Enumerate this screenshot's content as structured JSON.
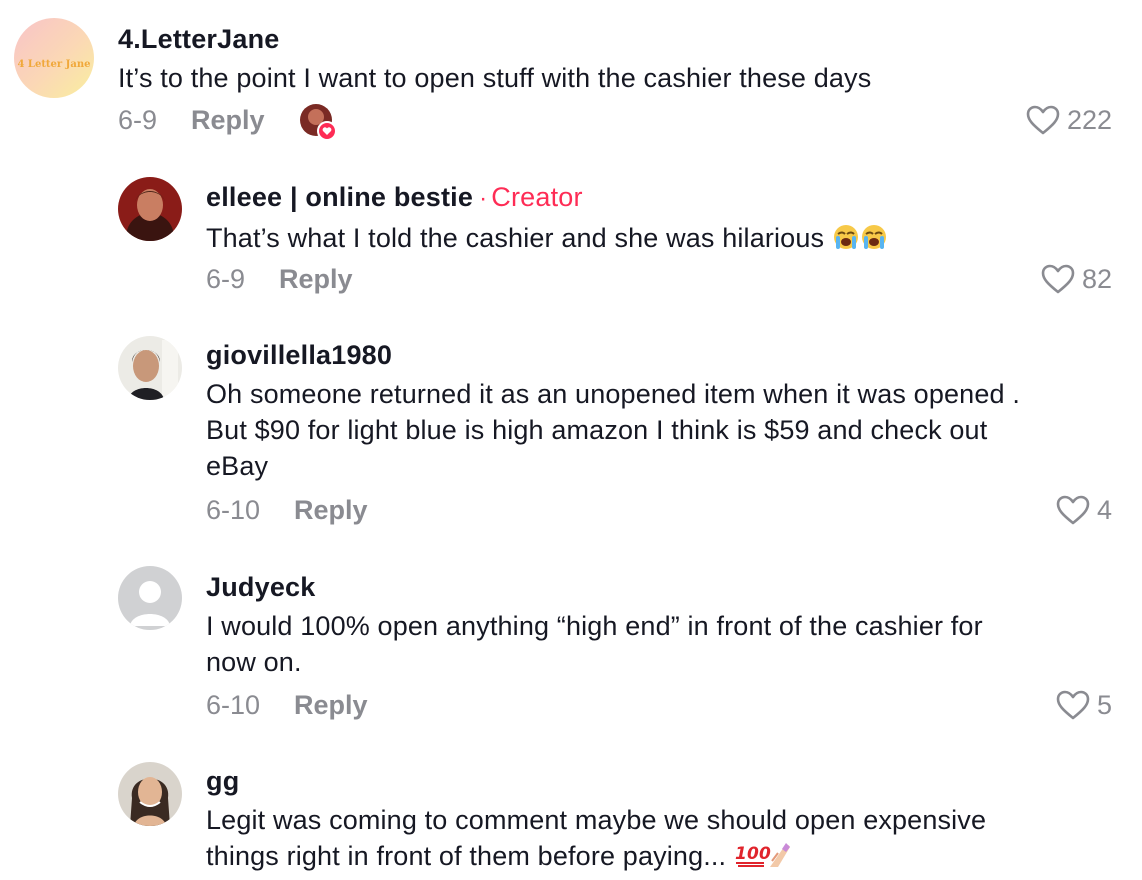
{
  "comments": [
    {
      "username": "4.LetterJane",
      "avatar_text": "4 Letter Jane",
      "text": "It’s to the point I want to open stuff with the cashier these days",
      "date": "6-9",
      "reply_label": "Reply",
      "likes": "222",
      "creator_liked": true
    },
    {
      "username": "elleee | online bestie",
      "separator": "·",
      "badge": "Creator",
      "text": "That’s what I told the cashier and she was hilarious",
      "emoji": "loudly-crying-face x2",
      "date": "6-9",
      "reply_label": "Reply",
      "likes": "82"
    },
    {
      "username": "giovillella1980",
      "text_lines": [
        "Oh someone returned it as an unopened item when it was opened .",
        "But $90 for light blue is high amazon I think is $59 and check out",
        "eBay"
      ],
      "date": "6-10",
      "reply_label": "Reply",
      "likes": "4"
    },
    {
      "username": "Judyeck",
      "text_lines": [
        "I would 100% open anything “high end” in front of the cashier for",
        "now on."
      ],
      "date": "6-10",
      "reply_label": "Reply",
      "likes": "5"
    },
    {
      "username": "gg",
      "text_lines": [
        "Legit was coming to comment maybe we should open expensive",
        "things right in front of them before paying..."
      ],
      "emoji": "hundred-points + nail-polish"
    }
  ],
  "colors": {
    "text": "#161823",
    "muted": "#8a8b91",
    "accent": "#fe2c55"
  },
  "icons": [
    "heart-outline-icon",
    "default-avatar-icon",
    "creator-liked-heart-icon"
  ]
}
